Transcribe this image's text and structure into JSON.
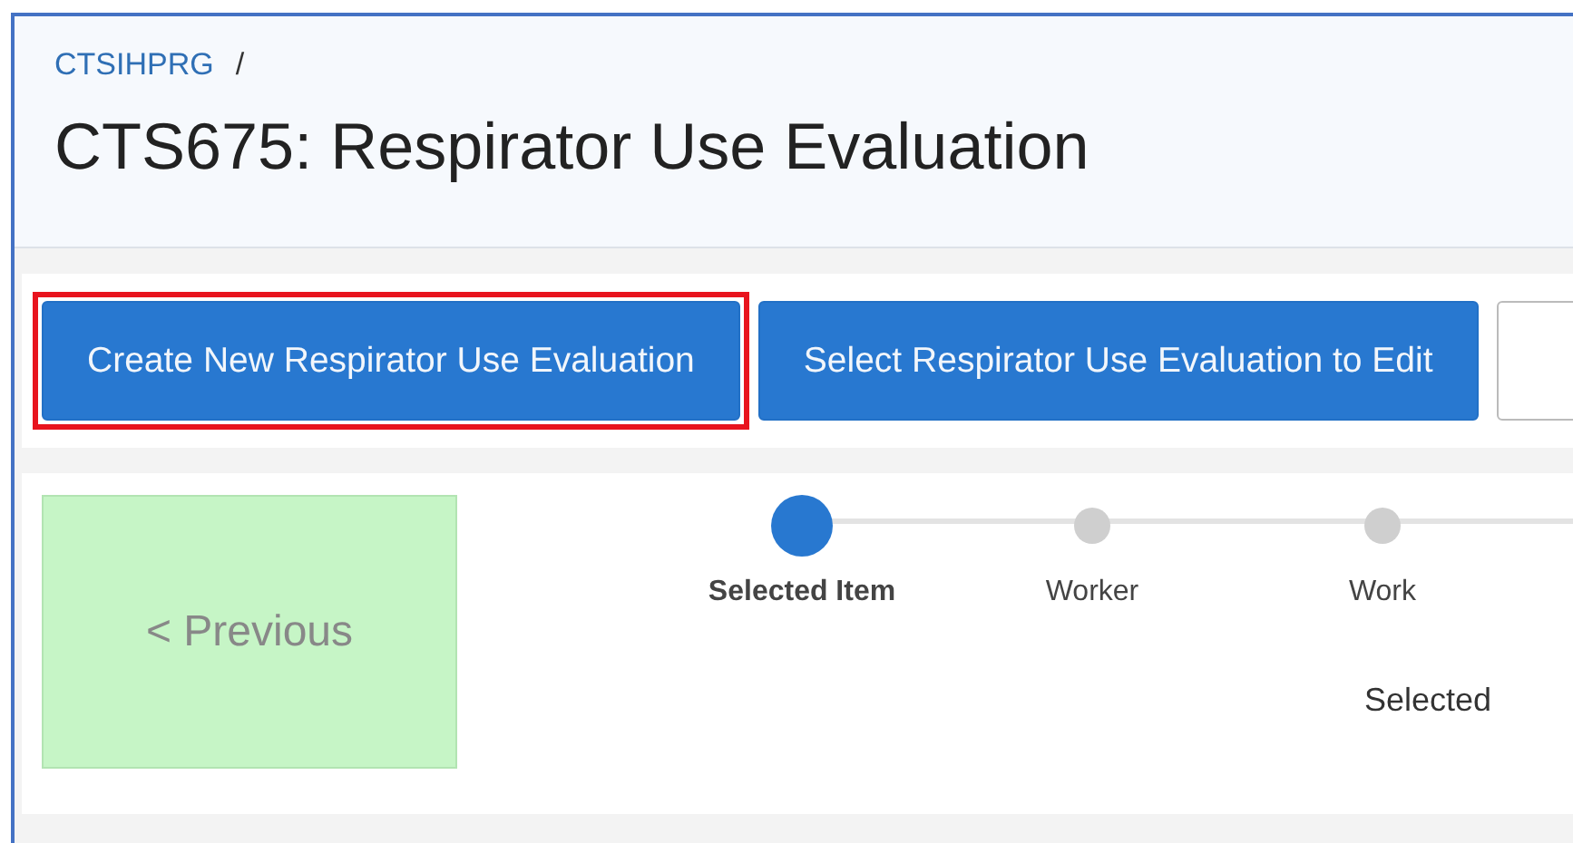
{
  "breadcrumb": {
    "link": "CTSIHPRG",
    "separator": "/"
  },
  "title": "CTS675: Respirator Use Evaluation",
  "buttons": [
    {
      "kind": "primary",
      "label": "Create New Respirator Use Evaluation",
      "highlighted": true
    },
    {
      "kind": "primary",
      "label": "Select Respirator Use Evaluation to Edit",
      "highlighted": false
    },
    {
      "kind": "outline",
      "highlighted": false
    }
  ],
  "previous_button": {
    "label": "< Previous"
  },
  "steps": [
    {
      "label": "Selected Item",
      "selected": true
    },
    {
      "label": "Worker",
      "selected": false
    },
    {
      "label": "Work",
      "selected": false
    }
  ],
  "content_text": "Selected"
}
